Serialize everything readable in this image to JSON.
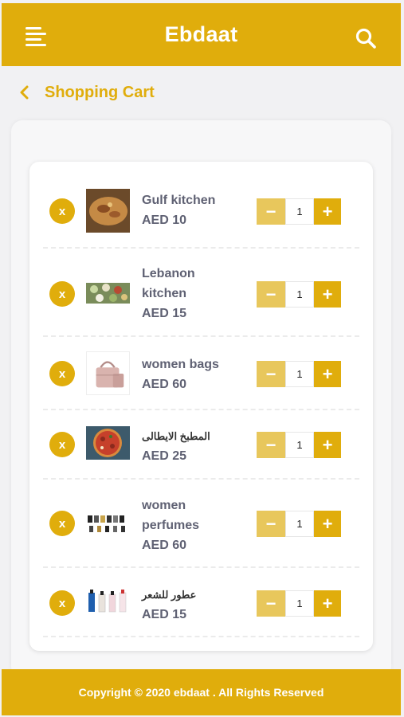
{
  "header": {
    "brand": "Ebdaat",
    "menu_icon": "menu-icon",
    "search_icon": "search-icon",
    "color": "#e0ad0c"
  },
  "breadcrumb": {
    "back_icon": "chevron-left-icon",
    "title": "Shopping Cart"
  },
  "cart": {
    "remove_label": "x",
    "minus_label": "−",
    "plus_label": "+",
    "items": [
      {
        "name": "Gulf kitchen",
        "price": "AED 10",
        "quantity": "1",
        "image": "rice-dish-image"
      },
      {
        "name": "Lebanon kitchen",
        "price": "AED 15",
        "quantity": "1",
        "image": "mezze-platter-image"
      },
      {
        "name": "women bags",
        "price": "AED 60",
        "quantity": "1",
        "image": "handbag-image"
      },
      {
        "name": "المطبخ الايطالى",
        "price": "AED 25",
        "quantity": "1",
        "image": "pizza-image"
      },
      {
        "name": "women perfumes",
        "price": "AED 60",
        "quantity": "1",
        "image": "perfume-bottles-image"
      },
      {
        "name": "عطور للشعر",
        "price": "AED 15",
        "quantity": "1",
        "image": "hair-perfume-image"
      }
    ]
  },
  "footer": {
    "text": "Copyright © 2020 ebdaat . All Rights Reserved"
  }
}
